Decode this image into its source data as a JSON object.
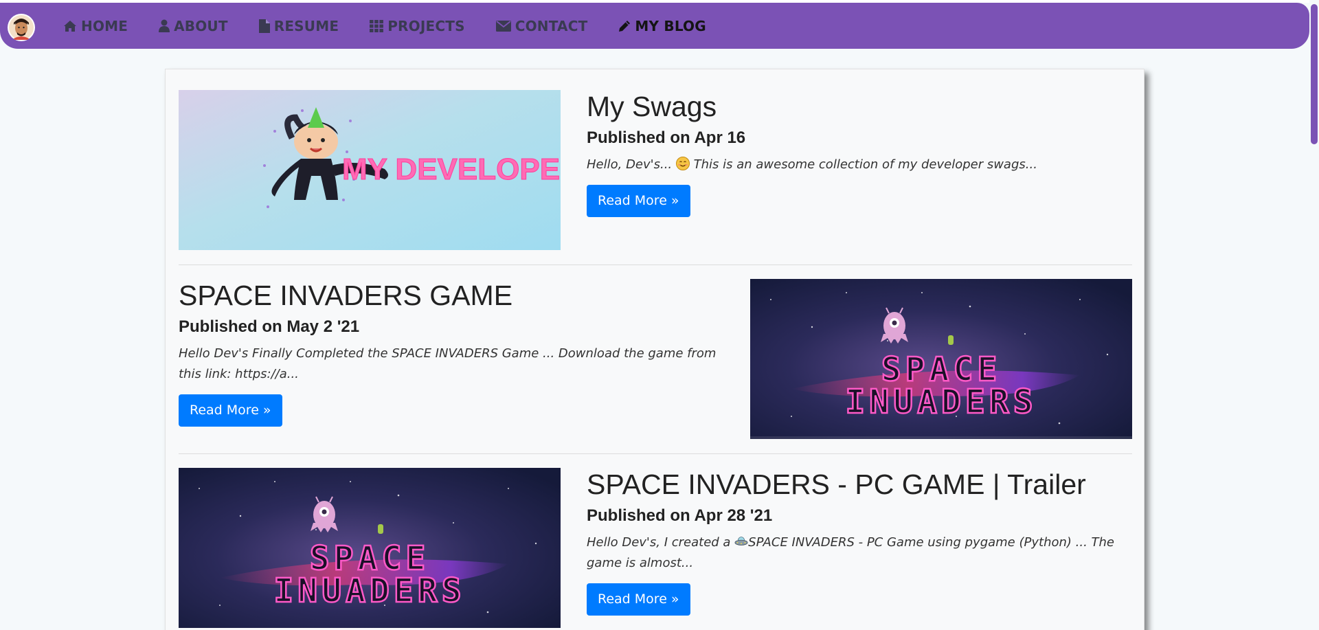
{
  "nav": {
    "items": [
      {
        "label": "HOME",
        "icon": "home-icon"
      },
      {
        "label": "ABOUT",
        "icon": "user-icon"
      },
      {
        "label": "RESUME",
        "icon": "file-icon"
      },
      {
        "label": "PROJECTS",
        "icon": "grid-icon"
      },
      {
        "label": "CONTACT",
        "icon": "envelope-icon"
      },
      {
        "label": "MY BLOG",
        "icon": "pencil-icon"
      }
    ],
    "active": "MY BLOG",
    "accent_color": "#7b52b5"
  },
  "posts": [
    {
      "title": "My Swags",
      "date": "Published on Apr 16",
      "excerpt_before": "Hello, Dev's... ",
      "excerpt_emoji": "smile-emoji",
      "excerpt_after": " This is an awesome collection of my developer swags...",
      "button": "Read More »",
      "image_text": "MY DEVELOPER SWAG"
    },
    {
      "title": "SPACE INVADERS GAME",
      "date": "Published on May 2 '21",
      "excerpt": "Hello Dev's Finally Completed the SPACE INVADERS Game ... Download the game from this link: https://a...",
      "button": "Read More »",
      "image_text_line1": "SPACE",
      "image_text_line2": "INUADERS"
    },
    {
      "title": "SPACE INVADERS - PC GAME | Trailer",
      "date": "Published on Apr 28 '21",
      "excerpt_before": "Hello Dev's, I created a ",
      "excerpt_emoji": "ufo-emoji",
      "excerpt_after": "SPACE INVADERS - PC Game using pygame (Python) ... The game is almost...",
      "button": "Read More »",
      "image_text_line1": "SPACE",
      "image_text_line2": "INUADERS"
    }
  ],
  "colors": {
    "button": "#007bff",
    "navbar": "#7b52b5",
    "background": "#f5f9fb"
  }
}
